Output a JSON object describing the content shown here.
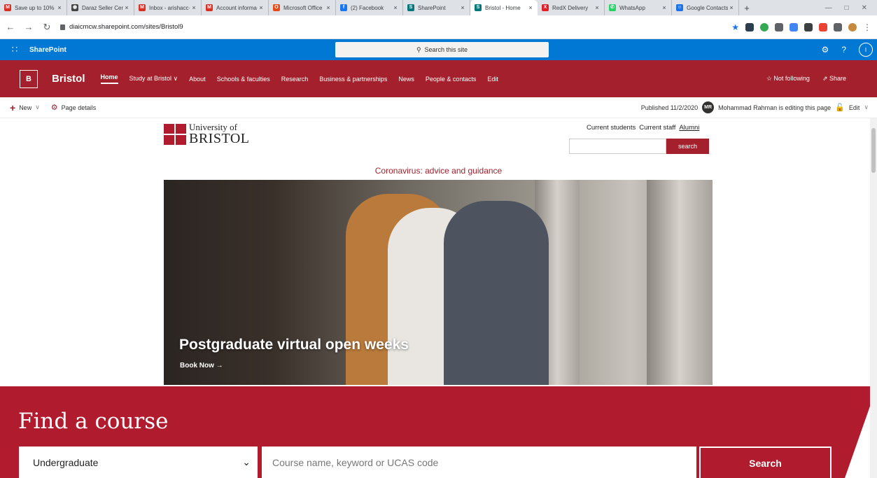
{
  "browser": {
    "tabs": [
      {
        "title": "Save up to 10% ·",
        "favicon": "gmail-icon",
        "color": "#d93025",
        "glyph": "M"
      },
      {
        "title": "Daraz Seller Cen·",
        "favicon": "daraz-icon",
        "color": "#444444",
        "glyph": "◉"
      },
      {
        "title": "Inbox - arishacc·",
        "favicon": "gmail-icon",
        "color": "#d93025",
        "glyph": "M"
      },
      {
        "title": "Account informa·",
        "favicon": "gmail-icon",
        "color": "#d93025",
        "glyph": "M"
      },
      {
        "title": "Microsoft Office",
        "favicon": "office-icon",
        "color": "#e64a19",
        "glyph": "O"
      },
      {
        "title": "(2) Facebook",
        "favicon": "facebook-icon",
        "color": "#1877f2",
        "glyph": "f"
      },
      {
        "title": "SharePoint",
        "favicon": "sharepoint-icon",
        "color": "#03787c",
        "glyph": "S"
      },
      {
        "title": "Bristol - Home",
        "favicon": "sharepoint-icon",
        "color": "#03787c",
        "glyph": "S",
        "active": true
      },
      {
        "title": "RedX Delivery",
        "favicon": "redx-icon",
        "color": "#e41e26",
        "glyph": "X"
      },
      {
        "title": "WhatsApp",
        "favicon": "whatsapp-icon",
        "color": "#25d366",
        "glyph": "✆"
      },
      {
        "title": "Google Contacts",
        "favicon": "contacts-icon",
        "color": "#1a73e8",
        "glyph": "☺"
      }
    ],
    "url": "diaicmcw.sharepoint.com/sites/Bristol9"
  },
  "sharepoint": {
    "app_name": "SharePoint",
    "search_placeholder": "Search this site",
    "help": "?",
    "user_initial": "I"
  },
  "site": {
    "logo_letter": "B",
    "title": "Bristol",
    "nav": [
      "Home",
      "Study at Bristol ∨",
      "About",
      "Schools & faculties",
      "Research",
      "Business & partnerships",
      "News",
      "People & contacts",
      "Edit"
    ],
    "not_following": "☆ Not following",
    "share": "⇗ Share"
  },
  "commandbar": {
    "new": "New",
    "page_details": "Page details",
    "published": "Published 11/2/2020",
    "editor_initials": "MR",
    "editing_text": "Mohammad Rahman is editing this page",
    "edit": "Edit"
  },
  "page": {
    "logo_line1": "University of",
    "logo_line2": "BRISTOL",
    "link_students": "Current students",
    "link_staff": "Current staff",
    "link_alumni": "Alumni",
    "search_button": "search",
    "covid_notice": "Coronavirus: advice and guidance",
    "hero_title": "Postgraduate virtual open weeks",
    "hero_link": "Book Now →",
    "find_course": "Find a course",
    "level_select": "Undergraduate",
    "course_placeholder": "Course name, keyword or UCAS code",
    "course_search": "Search"
  }
}
